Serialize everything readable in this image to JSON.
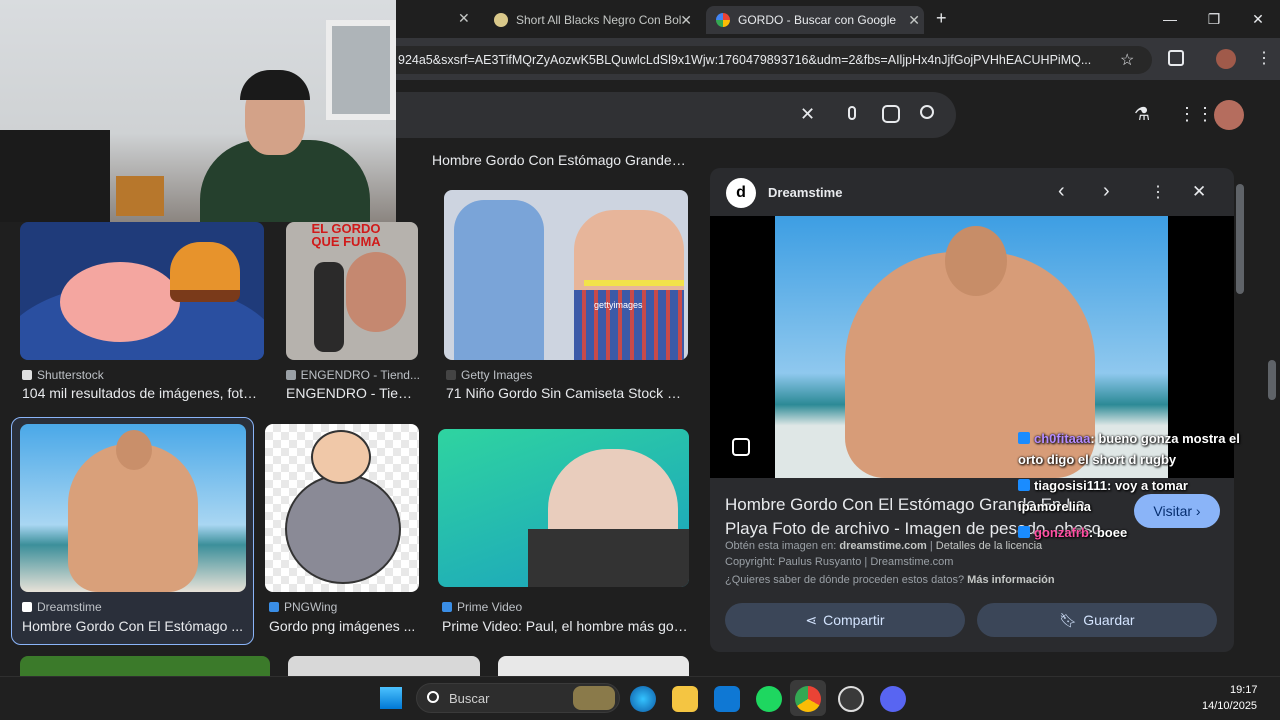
{
  "browser": {
    "tabs": [
      {
        "label": "Short All Blacks Negro Con Bol"
      },
      {
        "label": "GORDO - Buscar con Google"
      }
    ],
    "new_tab": "+",
    "url": "924a5&sxsrf=AE3TifMQrZyAozwK5BLQuwlcLdSl9x1Wjw:1760479893716&udm=2&fbs=AIljpHx4nJjfGojPVHhEACUHPiMQ..."
  },
  "results": {
    "top_caption": "Hombre Gordo Con Estómago Grande. ...",
    "row1": [
      {
        "source": "Shutterstock",
        "title": "104 mil resultados de imágenes, foto..."
      },
      {
        "source": "ENGENDRO - Tiend...",
        "title": "ENGENDRO - Tien...",
        "img_text": "EL GORDO QUE FUMA"
      },
      {
        "source": "Getty Images",
        "title": "71 Niño Gordo Sin Camiseta Stock P...",
        "img_text": "gettyimages"
      }
    ],
    "row2": [
      {
        "source": "Dreamstime",
        "title": "Hombre Gordo Con El Estómago ..."
      },
      {
        "source": "PNGWing",
        "title": "Gordo png imágenes ..."
      },
      {
        "source": "Prime Video",
        "title": "Prime Video: Paul, el hombre más gor..."
      }
    ]
  },
  "panel": {
    "source": "Dreamstime",
    "title": "Hombre Gordo Con El Estómago Grande En La Playa Foto de archivo - Imagen de pesado, obeso",
    "visit": "Visitar",
    "obtain_prefix": "Obtén esta imagen en:",
    "obtain_site": "dreamstime.com",
    "license": "Detalles de la licencia",
    "copyright": "Copyright: Paulus Rusyanto | Dreamstime.com",
    "question": "¿Quieres saber de dónde proceden estos datos?",
    "more": "Más información",
    "share": "Compartir",
    "save": "Guardar"
  },
  "chat": [
    {
      "user": "ch0fitaaa",
      "text": ": bueno gonza mostra el orto digo el short d rugby",
      "color": "#b48cff"
    },
    {
      "user": "tiagosisi111",
      "text": ": voy a tomar ipamorelina",
      "color": "#ffffff"
    },
    {
      "user": "gonzafrb",
      "text": ": boee",
      "color": "#ff4fa3"
    }
  ],
  "taskbar": {
    "search_placeholder": "Buscar",
    "time": "19:17",
    "date": "14/10/2025"
  },
  "colors": {
    "bg": "#1f1f1f",
    "accent": "#8ab4f8",
    "visit_btn": "#8ab4f8"
  }
}
